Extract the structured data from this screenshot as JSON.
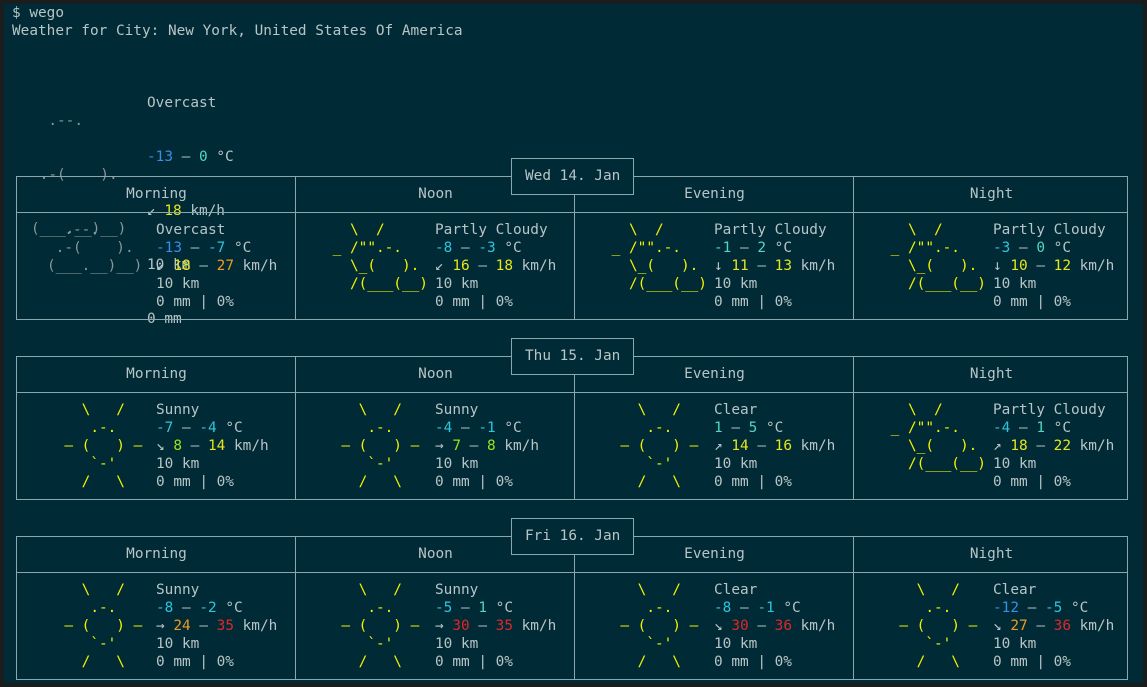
{
  "prompt": "$ wego",
  "city_line": "Weather for City: New York, United States Of America",
  "current": {
    "art": [
      "  .--.    ",
      " .-(    ). ",
      "(___.__)__)"
    ],
    "condition": "Overcast",
    "temp": [
      {
        "t": "-13",
        "c": "#3a8ee6"
      },
      {
        "t": " – ",
        "c": ""
      },
      {
        "t": "0",
        "c": "#4fd6c8"
      },
      {
        "t": " °C",
        "c": ""
      }
    ],
    "wind": [
      {
        "t": "↙ ",
        "c": ""
      },
      {
        "t": "18",
        "c": "#e6e61a"
      },
      {
        "t": " km/h",
        "c": ""
      }
    ],
    "visibility": "10 km",
    "precip": "0 mm"
  },
  "periods": [
    "Morning",
    "Noon",
    "Evening",
    "Night"
  ],
  "days": [
    {
      "date": "Wed 14. Jan",
      "cells": [
        {
          "art": "overcast",
          "condition": "Overcast",
          "temp": [
            {
              "t": "-13",
              "c": "#3a8ee6"
            },
            {
              "t": " – ",
              "c": ""
            },
            {
              "t": "-7",
              "c": "#2ec5dc"
            },
            {
              "t": " °C",
              "c": ""
            }
          ],
          "wind": [
            {
              "t": "↙ ",
              "c": ""
            },
            {
              "t": "18",
              "c": "#e6e61a"
            },
            {
              "t": " – ",
              "c": ""
            },
            {
              "t": "27",
              "c": "#ee9a20"
            },
            {
              "t": " km/h",
              "c": ""
            }
          ],
          "visibility": "10 km",
          "precip": "0 mm | 0%"
        },
        {
          "art": "partly",
          "condition": "Partly Cloudy",
          "temp": [
            {
              "t": "-8",
              "c": "#2ec5dc"
            },
            {
              "t": " – ",
              "c": ""
            },
            {
              "t": "-3",
              "c": "#2ec5dc"
            },
            {
              "t": " °C",
              "c": ""
            }
          ],
          "wind": [
            {
              "t": "↙ ",
              "c": ""
            },
            {
              "t": "16",
              "c": "#e6e61a"
            },
            {
              "t": " – ",
              "c": ""
            },
            {
              "t": "18",
              "c": "#e6e61a"
            },
            {
              "t": " km/h",
              "c": ""
            }
          ],
          "visibility": "10 km",
          "precip": "0 mm | 0%"
        },
        {
          "art": "partly",
          "condition": "Partly Cloudy",
          "temp": [
            {
              "t": "-1",
              "c": "#4fd6c8"
            },
            {
              "t": " – ",
              "c": ""
            },
            {
              "t": "2",
              "c": "#4fd6c8"
            },
            {
              "t": " °C",
              "c": ""
            }
          ],
          "wind": [
            {
              "t": "↓ ",
              "c": ""
            },
            {
              "t": "11",
              "c": "#e6e61a"
            },
            {
              "t": " – ",
              "c": ""
            },
            {
              "t": "13",
              "c": "#e6e61a"
            },
            {
              "t": " km/h",
              "c": ""
            }
          ],
          "visibility": "10 km",
          "precip": "0 mm | 0%"
        },
        {
          "art": "partly",
          "condition": "Partly Cloudy",
          "temp": [
            {
              "t": "-3",
              "c": "#2ec5dc"
            },
            {
              "t": " – ",
              "c": ""
            },
            {
              "t": "0",
              "c": "#4fd6c8"
            },
            {
              "t": " °C",
              "c": ""
            }
          ],
          "wind": [
            {
              "t": "↓ ",
              "c": ""
            },
            {
              "t": "10",
              "c": "#e6e61a"
            },
            {
              "t": " – ",
              "c": ""
            },
            {
              "t": "12",
              "c": "#e6e61a"
            },
            {
              "t": " km/h",
              "c": ""
            }
          ],
          "visibility": "10 km",
          "precip": "0 mm | 0%"
        }
      ]
    },
    {
      "date": "Thu 15. Jan",
      "cells": [
        {
          "art": "sunny",
          "condition": "Sunny",
          "temp": [
            {
              "t": "-7",
              "c": "#2ec5dc"
            },
            {
              "t": " – ",
              "c": ""
            },
            {
              "t": "-4",
              "c": "#2ec5dc"
            },
            {
              "t": " °C",
              "c": ""
            }
          ],
          "wind": [
            {
              "t": "↘ ",
              "c": ""
            },
            {
              "t": "8",
              "c": "#9ee31a"
            },
            {
              "t": " – ",
              "c": ""
            },
            {
              "t": "14",
              "c": "#e6e61a"
            },
            {
              "t": " km/h",
              "c": ""
            }
          ],
          "visibility": "10 km",
          "precip": "0 mm | 0%"
        },
        {
          "art": "sunny",
          "condition": "Sunny",
          "temp": [
            {
              "t": "-4",
              "c": "#2ec5dc"
            },
            {
              "t": " – ",
              "c": ""
            },
            {
              "t": "-1",
              "c": "#2ec5dc"
            },
            {
              "t": " °C",
              "c": ""
            }
          ],
          "wind": [
            {
              "t": "→ ",
              "c": ""
            },
            {
              "t": "7",
              "c": "#9ee31a"
            },
            {
              "t": " – ",
              "c": ""
            },
            {
              "t": "8",
              "c": "#9ee31a"
            },
            {
              "t": " km/h",
              "c": ""
            }
          ],
          "visibility": "10 km",
          "precip": "0 mm | 0%"
        },
        {
          "art": "sunny",
          "condition": "Clear",
          "temp": [
            {
              "t": "1",
              "c": "#4fd6c8"
            },
            {
              "t": " – ",
              "c": ""
            },
            {
              "t": "5",
              "c": "#4fd6c8"
            },
            {
              "t": " °C",
              "c": ""
            }
          ],
          "wind": [
            {
              "t": "↗ ",
              "c": ""
            },
            {
              "t": "14",
              "c": "#e6e61a"
            },
            {
              "t": " – ",
              "c": ""
            },
            {
              "t": "16",
              "c": "#e6e61a"
            },
            {
              "t": " km/h",
              "c": ""
            }
          ],
          "visibility": "10 km",
          "precip": "0 mm | 0%"
        },
        {
          "art": "partly",
          "condition": "Partly Cloudy",
          "temp": [
            {
              "t": "-4",
              "c": "#2ec5dc"
            },
            {
              "t": " – ",
              "c": ""
            },
            {
              "t": "1",
              "c": "#4fd6c8"
            },
            {
              "t": " °C",
              "c": ""
            }
          ],
          "wind": [
            {
              "t": "↗ ",
              "c": ""
            },
            {
              "t": "18",
              "c": "#e6e61a"
            },
            {
              "t": " – ",
              "c": ""
            },
            {
              "t": "22",
              "c": "#e6e61a"
            },
            {
              "t": " km/h",
              "c": ""
            }
          ],
          "visibility": "10 km",
          "precip": "0 mm | 0%"
        }
      ]
    },
    {
      "date": "Fri 16. Jan",
      "cells": [
        {
          "art": "sunny",
          "condition": "Sunny",
          "temp": [
            {
              "t": "-8",
              "c": "#2ec5dc"
            },
            {
              "t": " – ",
              "c": ""
            },
            {
              "t": "-2",
              "c": "#2ec5dc"
            },
            {
              "t": " °C",
              "c": ""
            }
          ],
          "wind": [
            {
              "t": "→ ",
              "c": ""
            },
            {
              "t": "24",
              "c": "#ee9a20"
            },
            {
              "t": " – ",
              "c": ""
            },
            {
              "t": "35",
              "c": "#e0262a"
            },
            {
              "t": " km/h",
              "c": ""
            }
          ],
          "visibility": "10 km",
          "precip": "0 mm | 0%"
        },
        {
          "art": "sunny",
          "condition": "Sunny",
          "temp": [
            {
              "t": "-5",
              "c": "#2ec5dc"
            },
            {
              "t": " – ",
              "c": ""
            },
            {
              "t": "1",
              "c": "#4fd6c8"
            },
            {
              "t": " °C",
              "c": ""
            }
          ],
          "wind": [
            {
              "t": "→ ",
              "c": ""
            },
            {
              "t": "30",
              "c": "#e0262a"
            },
            {
              "t": " – ",
              "c": ""
            },
            {
              "t": "35",
              "c": "#e0262a"
            },
            {
              "t": " km/h",
              "c": ""
            }
          ],
          "visibility": "10 km",
          "precip": "0 mm | 0%"
        },
        {
          "art": "sunny",
          "condition": "Clear",
          "temp": [
            {
              "t": "-8",
              "c": "#2ec5dc"
            },
            {
              "t": " – ",
              "c": ""
            },
            {
              "t": "-1",
              "c": "#2ec5dc"
            },
            {
              "t": " °C",
              "c": ""
            }
          ],
          "wind": [
            {
              "t": "↘ ",
              "c": ""
            },
            {
              "t": "30",
              "c": "#e0262a"
            },
            {
              "t": " – ",
              "c": ""
            },
            {
              "t": "36",
              "c": "#e0262a"
            },
            {
              "t": " km/h",
              "c": ""
            }
          ],
          "visibility": "10 km",
          "precip": "0 mm | 0%"
        },
        {
          "art": "sunny",
          "condition": "Clear",
          "temp": [
            {
              "t": "-12",
              "c": "#3a8ee6"
            },
            {
              "t": " – ",
              "c": ""
            },
            {
              "t": "-5",
              "c": "#2ec5dc"
            },
            {
              "t": " °C",
              "c": ""
            }
          ],
          "wind": [
            {
              "t": "↘ ",
              "c": ""
            },
            {
              "t": "27",
              "c": "#ee9a20"
            },
            {
              "t": " – ",
              "c": ""
            },
            {
              "t": "36",
              "c": "#e0262a"
            },
            {
              "t": " km/h",
              "c": ""
            }
          ],
          "visibility": "10 km",
          "precip": "0 mm | 0%"
        }
      ]
    }
  ],
  "art_sets": {
    "overcast": [
      "  .--.    ",
      " .-(    ). ",
      "(___.__)__)",
      "           ",
      "           "
    ],
    "partly": [
      "   \\  /    ",
      " _ /\"\".-.  ",
      "   \\_(   ). ",
      "   /(___(__)",
      "            "
    ],
    "sunny": [
      "    \\   /   ",
      "     .-.    ",
      "  ― (   ) ― ",
      "     `-'    ",
      "    /   \\   "
    ]
  },
  "colors": {
    "background": "#002b36",
    "border": "#8aa7ad",
    "text": "#b8c4c6",
    "sun": "#f2f200",
    "cloud": "#8a9799"
  }
}
